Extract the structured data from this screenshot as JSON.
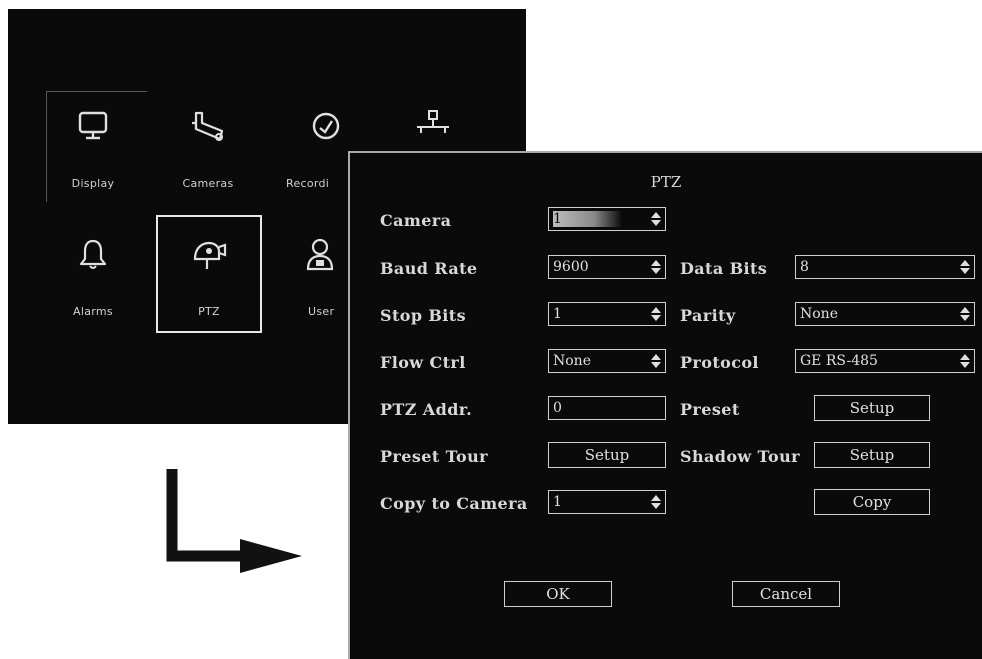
{
  "menu": {
    "tiles": [
      {
        "label": "Display",
        "icon": "monitor-icon"
      },
      {
        "label": "Cameras",
        "icon": "camera-icon"
      },
      {
        "label": "Recordi",
        "icon": "clock-icon"
      },
      {
        "label": "",
        "icon": "network-icon"
      },
      {
        "label": "Alarms",
        "icon": "bell-icon"
      },
      {
        "label": "PTZ",
        "icon": "ptz-camera-icon"
      },
      {
        "label": "User",
        "icon": "user-icon"
      }
    ],
    "selected": "PTZ"
  },
  "dialog": {
    "title": "PTZ",
    "camera": {
      "label": "Camera",
      "value": "1"
    },
    "baud_rate": {
      "label": "Baud Rate",
      "value": "9600"
    },
    "data_bits": {
      "label": "Data Bits",
      "value": "8"
    },
    "stop_bits": {
      "label": "Stop Bits",
      "value": "1"
    },
    "parity": {
      "label": "Parity",
      "value": "None"
    },
    "flow_ctrl": {
      "label": "Flow Ctrl",
      "value": "None"
    },
    "protocol": {
      "label": "Protocol",
      "value": "GE RS-485"
    },
    "ptz_addr": {
      "label": "PTZ Addr.",
      "value": "0"
    },
    "preset": {
      "label": "Preset",
      "button": "Setup"
    },
    "preset_tour": {
      "label": "Preset Tour",
      "button": "Setup"
    },
    "shadow_tour": {
      "label": "Shadow Tour",
      "button": "Setup"
    },
    "copy_to_camera": {
      "label": "Copy to Camera",
      "value": "1",
      "button": "Copy"
    },
    "ok_label": "OK",
    "cancel_label": "Cancel"
  },
  "colors": {
    "background": "#0a0a0a",
    "text": "#d8d8d8",
    "border": "#cfcfcf"
  }
}
